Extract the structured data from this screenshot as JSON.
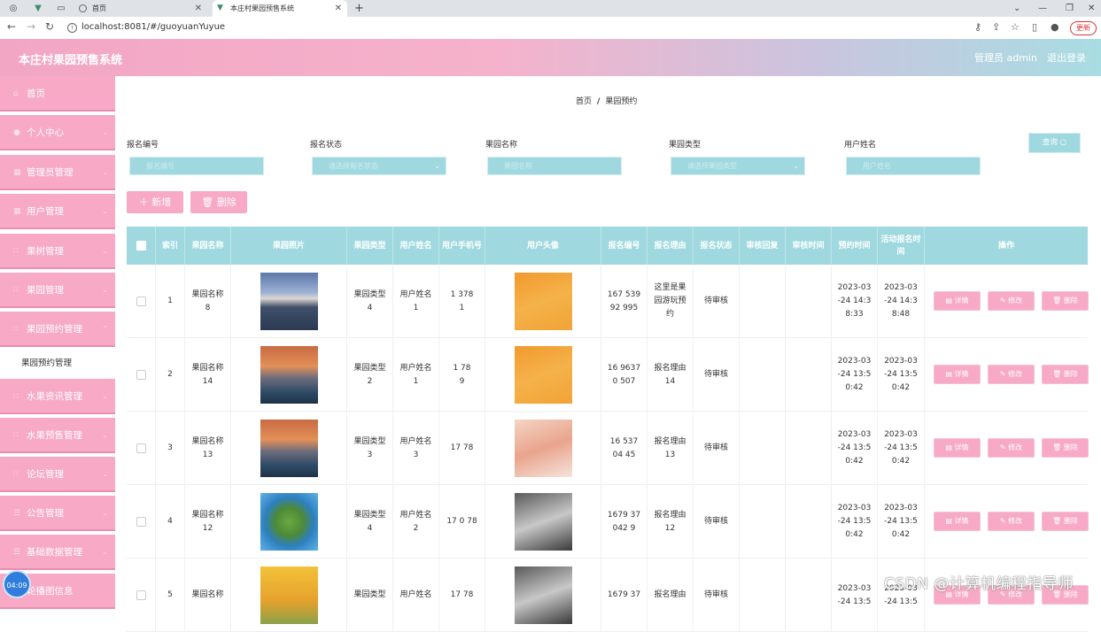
{
  "browser": {
    "tabs": [
      {
        "title": "首页"
      },
      {
        "title": "本庄村果园预售系统"
      }
    ],
    "url": "localhost:8081/#/guoyuanYuyue",
    "update_label": "更新"
  },
  "header": {
    "title": "本庄村果园预售系统",
    "admin_label": "管理员 admin",
    "logout_label": "退出登录"
  },
  "sidebar": {
    "items": [
      {
        "label": "首页"
      },
      {
        "label": "个人中心"
      },
      {
        "label": "管理员管理"
      },
      {
        "label": "用户管理"
      },
      {
        "label": "果树管理"
      },
      {
        "label": "果园管理"
      },
      {
        "label": "果园预约管理"
      },
      {
        "label": "水果资讯管理"
      },
      {
        "label": "水果预售管理"
      },
      {
        "label": "论坛管理"
      },
      {
        "label": "公告管理"
      },
      {
        "label": "基础数据管理"
      },
      {
        "label": "轮播图信息"
      }
    ],
    "sub_item": "果园预约管理"
  },
  "breadcrumb": {
    "home": "首页",
    "current": "果园预约"
  },
  "filters": {
    "labels": [
      "报名编号",
      "报名状态",
      "果园名称",
      "果园类型",
      "用户姓名"
    ],
    "placeholders": [
      "报名编号",
      "请选择报名状态",
      "果园名称",
      "请选择果园类型",
      "用户姓名"
    ],
    "query_label": "查询"
  },
  "actions": {
    "add_label": "新增",
    "delete_label": "删除"
  },
  "table": {
    "headers": [
      "索引",
      "果园名称",
      "果园照片",
      "果园类型",
      "用户姓名",
      "用户手机号",
      "用户头像",
      "报名编号",
      "报名理由",
      "报名状态",
      "审核回复",
      "审核时间",
      "预约时间",
      "活动报名时间",
      "操作"
    ],
    "rows": [
      {
        "index": "1",
        "name": "果园名称\n8",
        "type": "果园类型\n4",
        "user": "用户姓名\n1",
        "phone": "1    378\n   1",
        "code": "167 539\n92 995",
        "reason": "这里是果\n园游玩预\n约",
        "status": "待审核",
        "reply": "",
        "review_time": "",
        "book_time": "2023-03\n-24 14:3\n8:33",
        "signup_time": "2023-03\n-24 14:3\n8:48"
      },
      {
        "index": "2",
        "name": "果园名称\n14",
        "type": "果园类型\n2",
        "user": "用户姓名\n1",
        "phone": "1    78\n  9",
        "code": "16 9637\n0 507",
        "reason": "报名理由\n14",
        "status": "待审核",
        "reply": "",
        "review_time": "",
        "book_time": "2023-03\n-24 13:5\n0:42",
        "signup_time": "2023-03\n-24 13:5\n0:42"
      },
      {
        "index": "3",
        "name": "果园名称\n13",
        "type": "果园类型\n3",
        "user": "用户姓名\n3",
        "phone": "17   78\n   ",
        "code": "16 537\n04 45",
        "reason": "报名理由\n13",
        "status": "待审核",
        "reply": "",
        "review_time": "",
        "book_time": "2023-03\n-24 13:5\n0:42",
        "signup_time": "2023-03\n-24 13:5\n0:42"
      },
      {
        "index": "4",
        "name": "果园名称\n12",
        "type": "果园类型\n4",
        "user": "用户姓名\n2",
        "phone": "17 0 78\n  ",
        "code": "1679 37\n042 9",
        "reason": "报名理由\n12",
        "status": "待审核",
        "reply": "",
        "review_time": "",
        "book_time": "2023-03\n-24 13:5\n0:42",
        "signup_time": "2023-03\n-24 13:5\n0:42"
      },
      {
        "index": "5",
        "name": "果园名称",
        "type": "果园类型",
        "user": "用户姓名",
        "phone": "17   78",
        "code": "1679 37",
        "reason": "报名理由",
        "status": "待审核",
        "reply": "",
        "review_time": "",
        "book_time": "2023-03\n-24 13:5",
        "signup_time": "2023-03\n-24 13:5"
      }
    ],
    "op_labels": {
      "detail": "详情",
      "edit": "修改",
      "delete": "删除"
    }
  },
  "watermark": "CSDN @计算机编程指导师",
  "clock": "04:09"
}
